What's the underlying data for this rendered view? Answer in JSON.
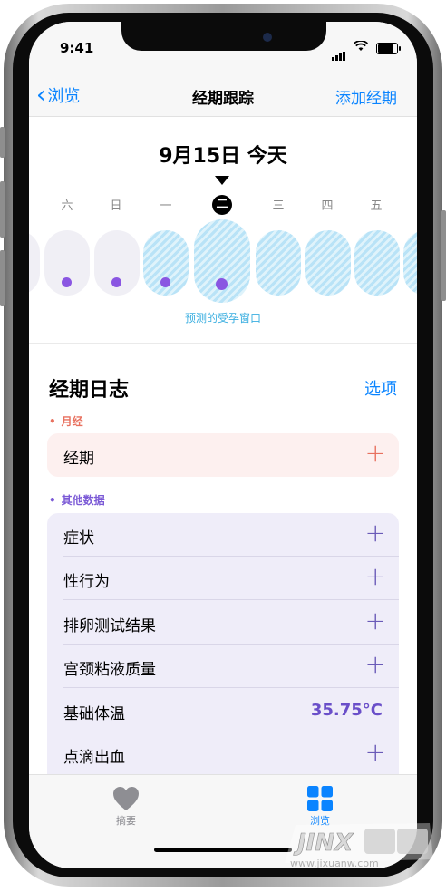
{
  "status_bar": {
    "time": "9:41"
  },
  "nav": {
    "back_label": "浏览",
    "title": "经期跟踪",
    "action_label": "添加经期"
  },
  "calendar": {
    "date_label": "9月15日 今天",
    "weekdays": [
      "六",
      "日",
      "一",
      "二",
      "三",
      "四",
      "五"
    ],
    "today_index": 3,
    "fertile_window_label": "预测的受孕窗口",
    "colors": {
      "fertile": "#b9e3f7",
      "dot": "#8a56e2",
      "pill": "#f0eff5"
    }
  },
  "log": {
    "title": "经期日志",
    "options_label": "选项",
    "menstruation_section": {
      "label": "月经",
      "color": "#e8715f",
      "rows": [
        {
          "label": "经期"
        }
      ]
    },
    "other_section": {
      "label": "其他数据",
      "color": "#7b5ad6",
      "rows": [
        {
          "label": "症状"
        },
        {
          "label": "性行为"
        },
        {
          "label": "排卵测试结果"
        },
        {
          "label": "宫颈粘液质量"
        },
        {
          "label": "基础体温",
          "value": "35.75°C"
        },
        {
          "label": "点滴出血"
        }
      ]
    }
  },
  "tabs": [
    {
      "label": "摘要",
      "icon": "heart-icon",
      "active": false
    },
    {
      "label": "浏览",
      "icon": "grid-icon",
      "active": true
    }
  ],
  "watermark": {
    "text": "www.jixuanw.com"
  }
}
